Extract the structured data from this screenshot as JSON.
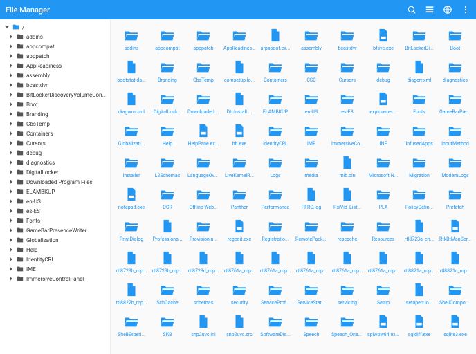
{
  "header": {
    "title": "File Manager"
  },
  "breadcrumb": "/",
  "sidebar": {
    "items": [
      {
        "label": "addins"
      },
      {
        "label": "appcompat"
      },
      {
        "label": "apppatch"
      },
      {
        "label": "AppReadiness"
      },
      {
        "label": "assembly"
      },
      {
        "label": "bcastdvr"
      },
      {
        "label": "BitLockerDiscoveryVolumeConten..."
      },
      {
        "label": "Boot"
      },
      {
        "label": "Branding"
      },
      {
        "label": "CbsTemp"
      },
      {
        "label": "Containers"
      },
      {
        "label": "Cursors"
      },
      {
        "label": "debug"
      },
      {
        "label": "diagnostics"
      },
      {
        "label": "DigitalLocker"
      },
      {
        "label": "Downloaded Program Files"
      },
      {
        "label": "ELAMBKUP"
      },
      {
        "label": "en-US"
      },
      {
        "label": "es-ES"
      },
      {
        "label": "Fonts"
      },
      {
        "label": "GameBarPresenceWriter"
      },
      {
        "label": "Globalization"
      },
      {
        "label": "Help"
      },
      {
        "label": "IdentityCRL"
      },
      {
        "label": "IME"
      },
      {
        "label": "ImmersiveControlPanel"
      }
    ]
  },
  "grid": {
    "items": [
      {
        "name": "addins",
        "type": "folder"
      },
      {
        "name": "appcompat",
        "type": "folder"
      },
      {
        "name": "apppatch",
        "type": "folder"
      },
      {
        "name": "AppReadines...",
        "type": "folder"
      },
      {
        "name": "arpspoof.ex...",
        "type": "file"
      },
      {
        "name": "assembly",
        "type": "folder"
      },
      {
        "name": "bcastdvr",
        "type": "folder"
      },
      {
        "name": "bfsvc.exe",
        "type": "exe"
      },
      {
        "name": "BitLockerDi...",
        "type": "folder"
      },
      {
        "name": "Boot",
        "type": "folder"
      },
      {
        "name": "bootstat.da...",
        "type": "file"
      },
      {
        "name": "Branding",
        "type": "folder"
      },
      {
        "name": "CbsTemp",
        "type": "folder"
      },
      {
        "name": "comsetup.lo...",
        "type": "file"
      },
      {
        "name": "Containers",
        "type": "folder"
      },
      {
        "name": "CSC",
        "type": "folder"
      },
      {
        "name": "Cursors",
        "type": "folder"
      },
      {
        "name": "debug",
        "type": "folder"
      },
      {
        "name": "diagerr.xml",
        "type": "file"
      },
      {
        "name": "diagnostics",
        "type": "folder"
      },
      {
        "name": "diagwrn.xml",
        "type": "file"
      },
      {
        "name": "DigitalLock...",
        "type": "folder"
      },
      {
        "name": "Downloaded ...",
        "type": "folder"
      },
      {
        "name": "DtcInstall....",
        "type": "file"
      },
      {
        "name": "ELAMBKUP",
        "type": "folder"
      },
      {
        "name": "en-US",
        "type": "folder"
      },
      {
        "name": "es-ES",
        "type": "folder"
      },
      {
        "name": "explorer.ex...",
        "type": "exe"
      },
      {
        "name": "Fonts",
        "type": "folder"
      },
      {
        "name": "GameBarPres...",
        "type": "folder"
      },
      {
        "name": "Globalizati...",
        "type": "folder"
      },
      {
        "name": "Help",
        "type": "folder"
      },
      {
        "name": "HelpPane.ex...",
        "type": "exe"
      },
      {
        "name": "hh.exe",
        "type": "exe"
      },
      {
        "name": "IdentityCRL",
        "type": "folder"
      },
      {
        "name": "IME",
        "type": "folder"
      },
      {
        "name": "ImmersiveCo...",
        "type": "folder"
      },
      {
        "name": "INF",
        "type": "folder"
      },
      {
        "name": "InfusedApps",
        "type": "folder"
      },
      {
        "name": "InputMethod",
        "type": "folder"
      },
      {
        "name": "Installer",
        "type": "folder"
      },
      {
        "name": "L2Schemas",
        "type": "folder"
      },
      {
        "name": "LanguageOve...",
        "type": "folder"
      },
      {
        "name": "LiveKernelR...",
        "type": "folder"
      },
      {
        "name": "Logs",
        "type": "folder"
      },
      {
        "name": "media",
        "type": "folder"
      },
      {
        "name": "mib.bin",
        "type": "file"
      },
      {
        "name": "Microsoft.N...",
        "type": "folder"
      },
      {
        "name": "Migration",
        "type": "folder"
      },
      {
        "name": "ModemLogs",
        "type": "folder"
      },
      {
        "name": "notepad.exe",
        "type": "exe"
      },
      {
        "name": "OCR",
        "type": "folder"
      },
      {
        "name": "Offline Web...",
        "type": "folder"
      },
      {
        "name": "Panther",
        "type": "folder"
      },
      {
        "name": "Performance",
        "type": "folder"
      },
      {
        "name": "PFRO.log",
        "type": "file"
      },
      {
        "name": "PsiVid_List...",
        "type": "file"
      },
      {
        "name": "PLA",
        "type": "folder"
      },
      {
        "name": "PolicyDefin...",
        "type": "folder"
      },
      {
        "name": "Prefetch",
        "type": "folder"
      },
      {
        "name": "PrintDialog",
        "type": "folder"
      },
      {
        "name": "Professiona...",
        "type": "file"
      },
      {
        "name": "Provisionin...",
        "type": "folder"
      },
      {
        "name": "regedit.exe",
        "type": "exe"
      },
      {
        "name": "Registratio...",
        "type": "folder"
      },
      {
        "name": "RemotePacka...",
        "type": "folder"
      },
      {
        "name": "rescache",
        "type": "folder"
      },
      {
        "name": "Resources",
        "type": "folder"
      },
      {
        "name": "rtl8723a_ch...",
        "type": "file"
      },
      {
        "name": "RtkBtManSer...",
        "type": "exe"
      },
      {
        "name": "rtl8723b_mp...",
        "type": "file"
      },
      {
        "name": "rtl8723b_mp...",
        "type": "file"
      },
      {
        "name": "rtl8723d_mp...",
        "type": "file"
      },
      {
        "name": "rtl8761a_mp...",
        "type": "file"
      },
      {
        "name": "rtl8761a_mp...",
        "type": "file"
      },
      {
        "name": "rtl8761a_mp...",
        "type": "file"
      },
      {
        "name": "rtl8761a_mp...",
        "type": "file"
      },
      {
        "name": "rtl8761a_mp...",
        "type": "file"
      },
      {
        "name": "rtl8821a_mp...",
        "type": "file"
      },
      {
        "name": "rtl8821c_mp...",
        "type": "file"
      },
      {
        "name": "rtl8822b_mp...",
        "type": "file"
      },
      {
        "name": "SchCache",
        "type": "folder"
      },
      {
        "name": "schemas",
        "type": "folder"
      },
      {
        "name": "security",
        "type": "folder"
      },
      {
        "name": "ServiceProf...",
        "type": "folder"
      },
      {
        "name": "ServiceStat...",
        "type": "folder"
      },
      {
        "name": "servicing",
        "type": "folder"
      },
      {
        "name": "Setup",
        "type": "folder"
      },
      {
        "name": "setuperr.lo...",
        "type": "file"
      },
      {
        "name": "ShellCompon...",
        "type": "folder"
      },
      {
        "name": "ShellExperi...",
        "type": "folder"
      },
      {
        "name": "SKB",
        "type": "folder"
      },
      {
        "name": "snp2uvc.ini",
        "type": "file"
      },
      {
        "name": "snp2uvc.src",
        "type": "file"
      },
      {
        "name": "SoftwareDis...",
        "type": "folder"
      },
      {
        "name": "Speech",
        "type": "folder"
      },
      {
        "name": "Speech_OneC...",
        "type": "folder"
      },
      {
        "name": "splwow64.ex...",
        "type": "exe"
      },
      {
        "name": "sqldiff.exe",
        "type": "exe"
      },
      {
        "name": "sqlite3.exe",
        "type": "exe"
      }
    ]
  }
}
